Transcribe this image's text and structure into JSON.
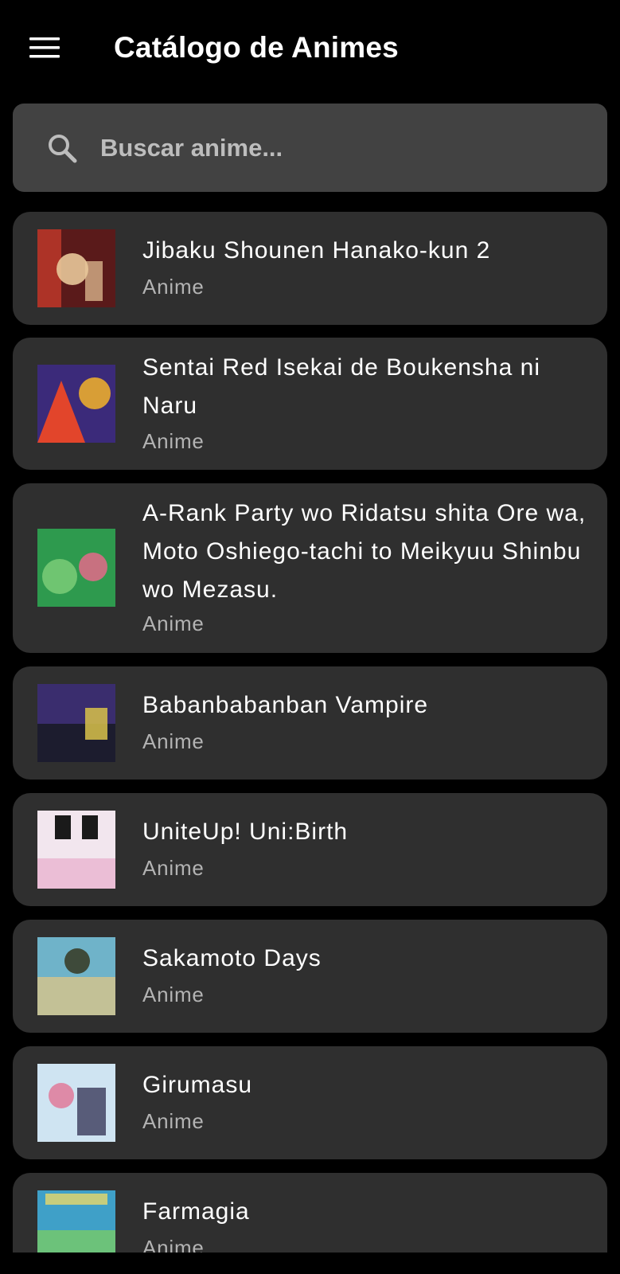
{
  "app_bar": {
    "title": "Catálogo de Animes",
    "menu_icon": "hamburger-menu-icon"
  },
  "search": {
    "placeholder": "Buscar anime...",
    "value": "",
    "icon": "search-icon"
  },
  "anime_list": [
    {
      "title": "Jibaku Shounen Hanako-kun 2",
      "type": "Anime",
      "thumb_colors": [
        "#5a1a1a",
        "#c23a2b",
        "#e8c89a"
      ]
    },
    {
      "title": "Sentai Red Isekai de Boukensha ni Naru",
      "type": "Anime",
      "thumb_colors": [
        "#3b2a7a",
        "#e2452b",
        "#f5b32a"
      ]
    },
    {
      "title": "A-Rank Party wo Ridatsu shita Ore wa, Moto Oshiego-tachi to Meikyuu Shinbu wo Mezasu.",
      "type": "Anime",
      "thumb_colors": [
        "#2e9a4e",
        "#7fd07a",
        "#e36a8a"
      ]
    },
    {
      "title": "Babanbabanban Vampire",
      "type": "Anime",
      "thumb_colors": [
        "#3a2d6e",
        "#1c1c2e",
        "#d9c24a"
      ]
    },
    {
      "title": "UniteUp! Uni:Birth",
      "type": "Anime",
      "thumb_colors": [
        "#f2e6ee",
        "#1a1a1a",
        "#e9b4d0"
      ]
    },
    {
      "title": "Sakamoto Days",
      "type": "Anime",
      "thumb_colors": [
        "#6fb3c9",
        "#d8c48a",
        "#3e4a3a"
      ]
    },
    {
      "title": "Girumasu",
      "type": "Anime",
      "thumb_colors": [
        "#cfe4f2",
        "#e07a9a",
        "#3a3a5a"
      ]
    },
    {
      "title": "Farmagia",
      "type": "Anime",
      "thumb_colors": [
        "#3fa0c8",
        "#6cc27a",
        "#e8d86a"
      ]
    }
  ]
}
